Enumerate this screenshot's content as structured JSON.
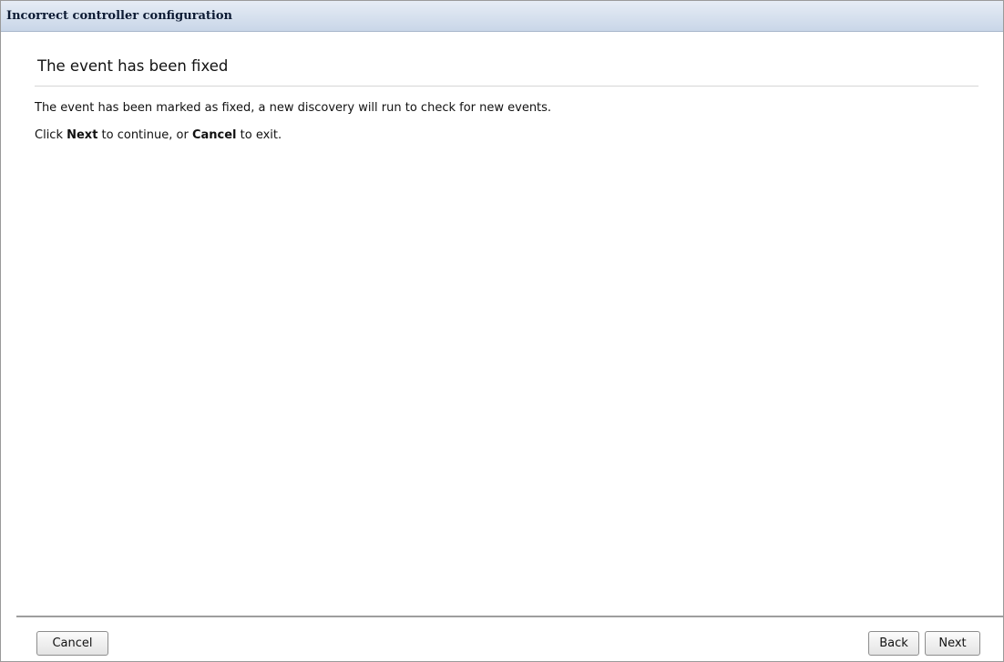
{
  "window": {
    "title": "Incorrect controller configuration"
  },
  "main": {
    "heading": "The event has been fixed",
    "paragraph1": "The event has been marked as fixed, a new discovery will run to check for new events.",
    "paragraph2": {
      "prefix": "Click ",
      "next_word": "Next",
      "middle": " to continue, or ",
      "cancel_word": "Cancel",
      "suffix": " to exit."
    }
  },
  "footer": {
    "cancel_label": "Cancel",
    "back_label": "Back",
    "next_label": "Next"
  }
}
